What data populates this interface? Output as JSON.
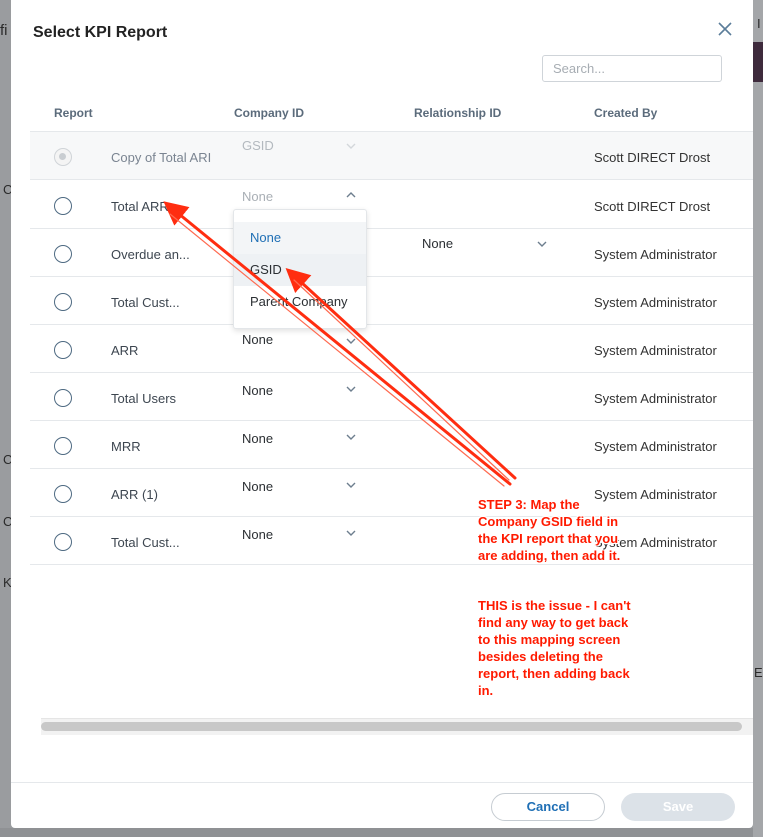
{
  "background": {
    "fragments": [
      "fi",
      "C",
      "C",
      "C",
      "C",
      "K",
      "E",
      "I"
    ]
  },
  "modal": {
    "title": "Select KPI Report",
    "search_placeholder": "Search...",
    "columns": [
      "Report",
      "Company ID",
      "Relationship ID",
      "Created By"
    ],
    "rows": [
      {
        "name": "Copy of Total ARI",
        "company_id": "GSID",
        "created_by": "Scott DIRECT Drost",
        "state": "disabled"
      },
      {
        "name": "Total ARR ...",
        "company_id": "None",
        "created_by": "Scott DIRECT Drost",
        "state": "dropdown-open"
      },
      {
        "name": "Overdue an...",
        "company_id": "",
        "created_by": "System Administrator",
        "relationship_id": "None"
      },
      {
        "name": "Total Cust...",
        "company_id": "",
        "created_by": "System Administrator"
      },
      {
        "name": "ARR",
        "company_id": "None",
        "created_by": "System Administrator"
      },
      {
        "name": "Total Users",
        "company_id": "None",
        "created_by": "System Administrator"
      },
      {
        "name": "MRR",
        "company_id": "None",
        "created_by": "System Administrator"
      },
      {
        "name": "ARR (1)",
        "company_id": "None",
        "created_by": "System Administrator"
      },
      {
        "name": "Total Cust...",
        "company_id": "None",
        "created_by": "System Administrator"
      }
    ],
    "dropdown_options": [
      "None",
      "GSID",
      "Parent Company"
    ],
    "cancel_label": "Cancel",
    "save_label": "Save"
  },
  "annotation": {
    "line1": "STEP 3: Map the Company GSID field in the KPI report that you are adding, then add it.",
    "line2": "THIS is the issue - I can't find any way to get back to this mapping screen besides deleting the report, then adding back in.",
    "color": "#ff1a00"
  },
  "colors": {
    "accent": "#1f6fb5",
    "header_text": "#5b6b7b",
    "annotation": "#ff1a00"
  }
}
